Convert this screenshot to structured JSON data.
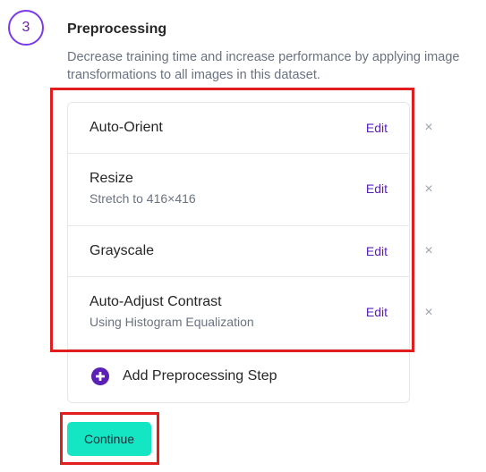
{
  "step": {
    "number": "3",
    "title": "Preprocessing",
    "description": "Decrease training time and increase performance by applying image transformations to all images in this dataset."
  },
  "preprocessing_steps": [
    {
      "name": "Auto-Orient",
      "detail": "",
      "edit_label": "Edit",
      "remove_icon": "×"
    },
    {
      "name": "Resize",
      "detail": "Stretch to 416×416",
      "edit_label": "Edit",
      "remove_icon": "×"
    },
    {
      "name": "Grayscale",
      "detail": "",
      "edit_label": "Edit",
      "remove_icon": "×"
    },
    {
      "name": "Auto-Adjust Contrast",
      "detail": "Using Histogram Equalization",
      "edit_label": "Edit",
      "remove_icon": "×"
    }
  ],
  "add_step": {
    "label": "Add Preprocessing Step",
    "icon": "plus-circle-icon"
  },
  "continue_label": "Continue",
  "colors": {
    "accent_purple": "#6b21a8",
    "continue_button": "#14e5c3",
    "highlight_red": "#e11d1d"
  }
}
